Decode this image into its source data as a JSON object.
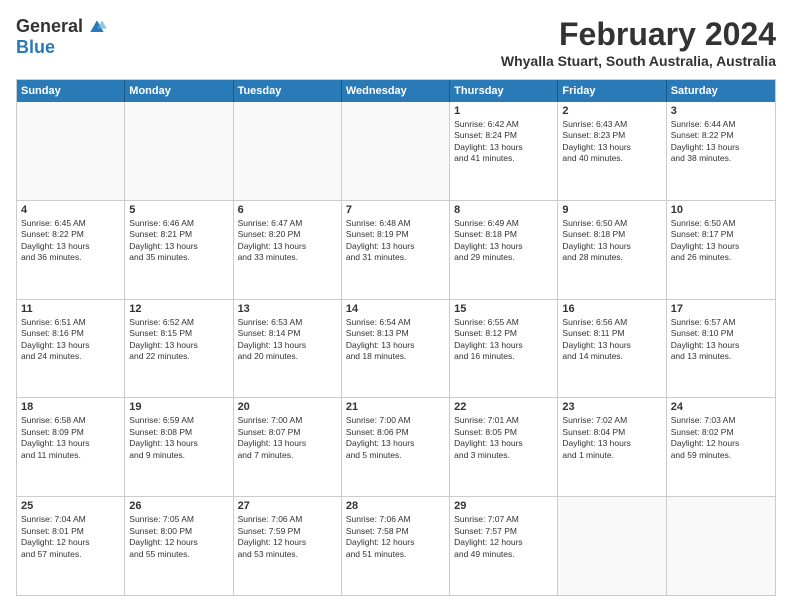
{
  "logo": {
    "general": "General",
    "blue": "Blue"
  },
  "title": "February 2024",
  "location": "Whyalla Stuart, South Australia, Australia",
  "days_header": [
    "Sunday",
    "Monday",
    "Tuesday",
    "Wednesday",
    "Thursday",
    "Friday",
    "Saturday"
  ],
  "rows": [
    [
      {
        "day": "",
        "info": ""
      },
      {
        "day": "",
        "info": ""
      },
      {
        "day": "",
        "info": ""
      },
      {
        "day": "",
        "info": ""
      },
      {
        "day": "1",
        "info": "Sunrise: 6:42 AM\nSunset: 8:24 PM\nDaylight: 13 hours\nand 41 minutes."
      },
      {
        "day": "2",
        "info": "Sunrise: 6:43 AM\nSunset: 8:23 PM\nDaylight: 13 hours\nand 40 minutes."
      },
      {
        "day": "3",
        "info": "Sunrise: 6:44 AM\nSunset: 8:22 PM\nDaylight: 13 hours\nand 38 minutes."
      }
    ],
    [
      {
        "day": "4",
        "info": "Sunrise: 6:45 AM\nSunset: 8:22 PM\nDaylight: 13 hours\nand 36 minutes."
      },
      {
        "day": "5",
        "info": "Sunrise: 6:46 AM\nSunset: 8:21 PM\nDaylight: 13 hours\nand 35 minutes."
      },
      {
        "day": "6",
        "info": "Sunrise: 6:47 AM\nSunset: 8:20 PM\nDaylight: 13 hours\nand 33 minutes."
      },
      {
        "day": "7",
        "info": "Sunrise: 6:48 AM\nSunset: 8:19 PM\nDaylight: 13 hours\nand 31 minutes."
      },
      {
        "day": "8",
        "info": "Sunrise: 6:49 AM\nSunset: 8:18 PM\nDaylight: 13 hours\nand 29 minutes."
      },
      {
        "day": "9",
        "info": "Sunrise: 6:50 AM\nSunset: 8:18 PM\nDaylight: 13 hours\nand 28 minutes."
      },
      {
        "day": "10",
        "info": "Sunrise: 6:50 AM\nSunset: 8:17 PM\nDaylight: 13 hours\nand 26 minutes."
      }
    ],
    [
      {
        "day": "11",
        "info": "Sunrise: 6:51 AM\nSunset: 8:16 PM\nDaylight: 13 hours\nand 24 minutes."
      },
      {
        "day": "12",
        "info": "Sunrise: 6:52 AM\nSunset: 8:15 PM\nDaylight: 13 hours\nand 22 minutes."
      },
      {
        "day": "13",
        "info": "Sunrise: 6:53 AM\nSunset: 8:14 PM\nDaylight: 13 hours\nand 20 minutes."
      },
      {
        "day": "14",
        "info": "Sunrise: 6:54 AM\nSunset: 8:13 PM\nDaylight: 13 hours\nand 18 minutes."
      },
      {
        "day": "15",
        "info": "Sunrise: 6:55 AM\nSunset: 8:12 PM\nDaylight: 13 hours\nand 16 minutes."
      },
      {
        "day": "16",
        "info": "Sunrise: 6:56 AM\nSunset: 8:11 PM\nDaylight: 13 hours\nand 14 minutes."
      },
      {
        "day": "17",
        "info": "Sunrise: 6:57 AM\nSunset: 8:10 PM\nDaylight: 13 hours\nand 13 minutes."
      }
    ],
    [
      {
        "day": "18",
        "info": "Sunrise: 6:58 AM\nSunset: 8:09 PM\nDaylight: 13 hours\nand 11 minutes."
      },
      {
        "day": "19",
        "info": "Sunrise: 6:59 AM\nSunset: 8:08 PM\nDaylight: 13 hours\nand 9 minutes."
      },
      {
        "day": "20",
        "info": "Sunrise: 7:00 AM\nSunset: 8:07 PM\nDaylight: 13 hours\nand 7 minutes."
      },
      {
        "day": "21",
        "info": "Sunrise: 7:00 AM\nSunset: 8:06 PM\nDaylight: 13 hours\nand 5 minutes."
      },
      {
        "day": "22",
        "info": "Sunrise: 7:01 AM\nSunset: 8:05 PM\nDaylight: 13 hours\nand 3 minutes."
      },
      {
        "day": "23",
        "info": "Sunrise: 7:02 AM\nSunset: 8:04 PM\nDaylight: 13 hours\nand 1 minute."
      },
      {
        "day": "24",
        "info": "Sunrise: 7:03 AM\nSunset: 8:02 PM\nDaylight: 12 hours\nand 59 minutes."
      }
    ],
    [
      {
        "day": "25",
        "info": "Sunrise: 7:04 AM\nSunset: 8:01 PM\nDaylight: 12 hours\nand 57 minutes."
      },
      {
        "day": "26",
        "info": "Sunrise: 7:05 AM\nSunset: 8:00 PM\nDaylight: 12 hours\nand 55 minutes."
      },
      {
        "day": "27",
        "info": "Sunrise: 7:06 AM\nSunset: 7:59 PM\nDaylight: 12 hours\nand 53 minutes."
      },
      {
        "day": "28",
        "info": "Sunrise: 7:06 AM\nSunset: 7:58 PM\nDaylight: 12 hours\nand 51 minutes."
      },
      {
        "day": "29",
        "info": "Sunrise: 7:07 AM\nSunset: 7:57 PM\nDaylight: 12 hours\nand 49 minutes."
      },
      {
        "day": "",
        "info": ""
      },
      {
        "day": "",
        "info": ""
      }
    ]
  ]
}
